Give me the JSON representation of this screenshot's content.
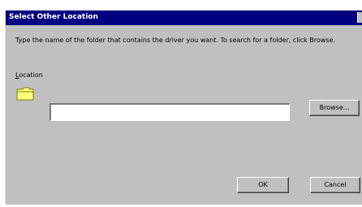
{
  "dialog": {
    "title": "Select Other Location",
    "instructions": "Type the name of the folder that contains the driver you want. To search for a folder, click Browse.",
    "location_label_accel": "L",
    "location_label_rest": "ocation",
    "location_value": "",
    "folder_icon": "folder-icon",
    "buttons": {
      "browse": "Browse...",
      "ok": "OK",
      "cancel": "Cancel"
    }
  },
  "colors": {
    "titlebar": "#000080",
    "face": "#c0c0c0",
    "folder": "#ffff80"
  }
}
